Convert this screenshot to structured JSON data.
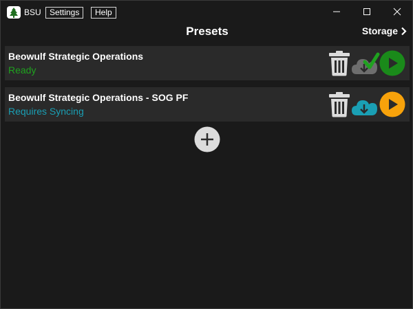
{
  "app": {
    "title": "BSU",
    "menu": [
      "Settings",
      "Help"
    ]
  },
  "window_controls": [
    "minimize-icon",
    "maximize-icon",
    "close-icon"
  ],
  "header": {
    "title": "Presets",
    "storage_label": "Storage"
  },
  "presets": [
    {
      "name": "Beowulf Strategic Operations",
      "status": "Ready",
      "status_color": "#1fa21f",
      "cloud_icon": "cloud-download-checked-icon",
      "play_color": "#1a8a1a"
    },
    {
      "name": "Beowulf Strategic Operations - SOG PF",
      "status": "Requires Syncing",
      "status_color": "#1a9fb4",
      "cloud_icon": "cloud-download-icon",
      "play_color": "#f7a20b"
    }
  ],
  "colors": {
    "background": "#1a1a1a",
    "row_background": "#2a2a2a",
    "icon_gray": "#dcdcdc",
    "sync_cyan": "#1a9fb4",
    "ready_green": "#1a8a1a",
    "play_orange": "#f7a20b"
  }
}
